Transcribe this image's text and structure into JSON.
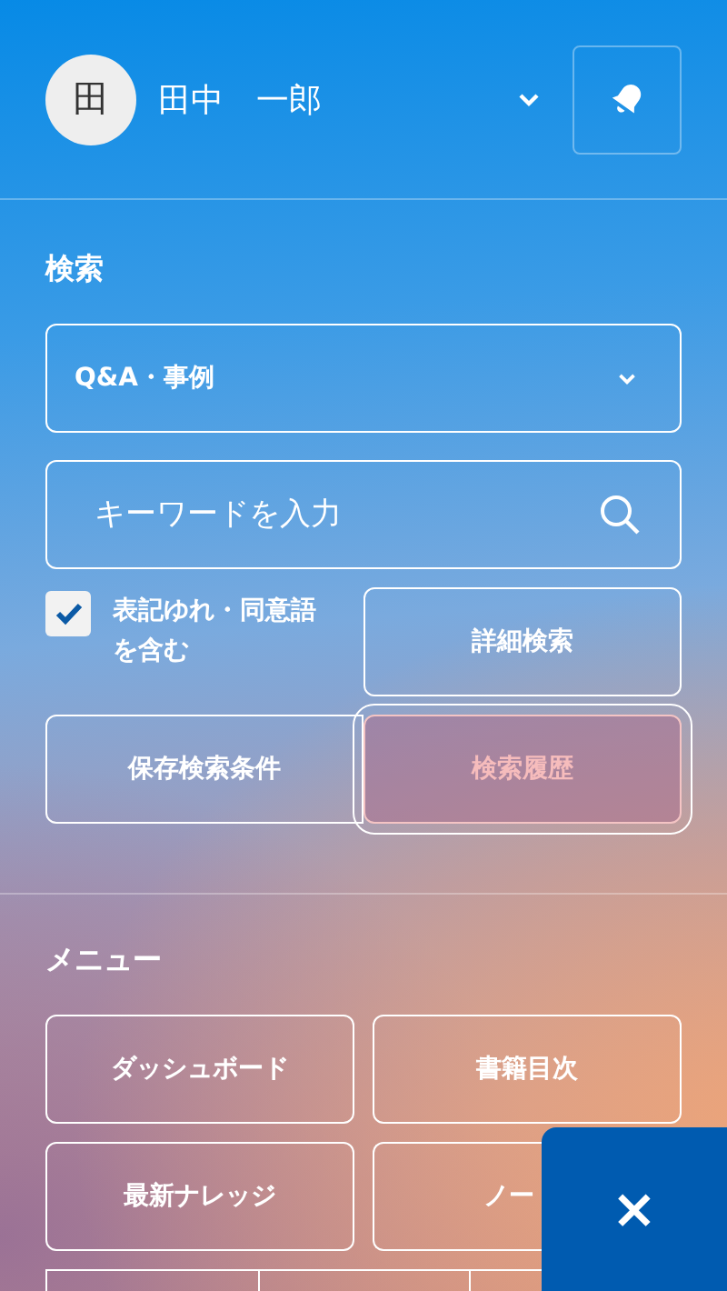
{
  "user": {
    "avatar": "田",
    "name": "田中　一郎"
  },
  "search": {
    "title": "検索",
    "category": "Q&A・事例",
    "keyword": {
      "placeholder": "キーワードを入力"
    },
    "option": {
      "label": "表記ゆれ・同意語を含む",
      "checked": true
    },
    "buttons": [
      {
        "label": "詳細検索",
        "focused": false
      },
      {
        "label": "保存検索条件",
        "focused": false
      },
      {
        "label": "検索履歴",
        "focused": true
      }
    ]
  },
  "menu": {
    "title": "メニュー",
    "items": [
      {
        "label": "ダッシュボード"
      },
      {
        "label": "書籍目次"
      },
      {
        "label": "最新ナレッジ"
      },
      {
        "label": "ノー"
      }
    ]
  },
  "close": {
    "symbol": "×"
  }
}
